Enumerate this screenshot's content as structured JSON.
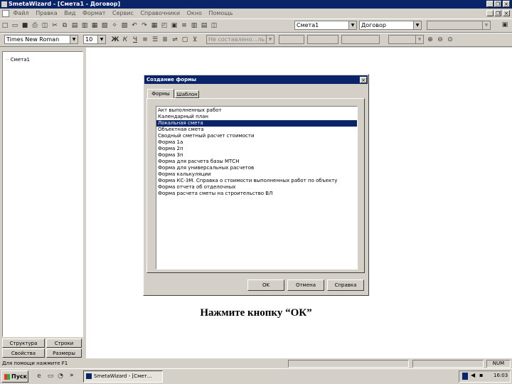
{
  "window": {
    "title": "SmetaWizard - [Смета1 - Договор]"
  },
  "menu": [
    "Файл",
    "Правка",
    "Вид",
    "Формат",
    "Сервис",
    "Справочники",
    "Окно",
    "Помощь"
  ],
  "toolbar": {
    "combo_smeta": "Смета1",
    "combo_dogovor": "Договор",
    "font_name": "Times New Roman",
    "font_size": "10",
    "bold": "Ж",
    "italic": "К",
    "underline": "Ч",
    "combo_disabled": "Не составлено...ль"
  },
  "left_panel": {
    "tree_item": "Смета1",
    "tabs": [
      "Структура",
      "Строки",
      "Свойства",
      "Размеры"
    ]
  },
  "dialog": {
    "title": "Создание формы",
    "tabs": [
      "Формы",
      "Шаблон"
    ],
    "items": [
      "Акт выполненных работ",
      "Календарный план",
      "Локальная смета",
      "Объектная смета",
      "Сводный сметный расчет стоимости",
      "Форма 1а",
      "Форма 2п",
      "Форма 3п",
      "Форма для расчета базы МТСН",
      "Форма для универсальных расчетов",
      "Форма калькуляции",
      "Форма КС-3М. Справка о стоимости выполненных работ по объекту",
      "Форма отчета об отделочных",
      "Форма расчета сметы на строительство ВЛ"
    ],
    "selected_index": 2,
    "buttons": {
      "ok": "OK",
      "cancel": "Отмена",
      "help": "Справка"
    }
  },
  "caption": "Нажмите кнопку “ОК”",
  "status": {
    "text": "Для помощи нажмите F1",
    "indicator": "NUM"
  },
  "taskbar": {
    "start": "Пуск",
    "task": "SmetaWizard - [Смет...",
    "clock": "16:03"
  }
}
